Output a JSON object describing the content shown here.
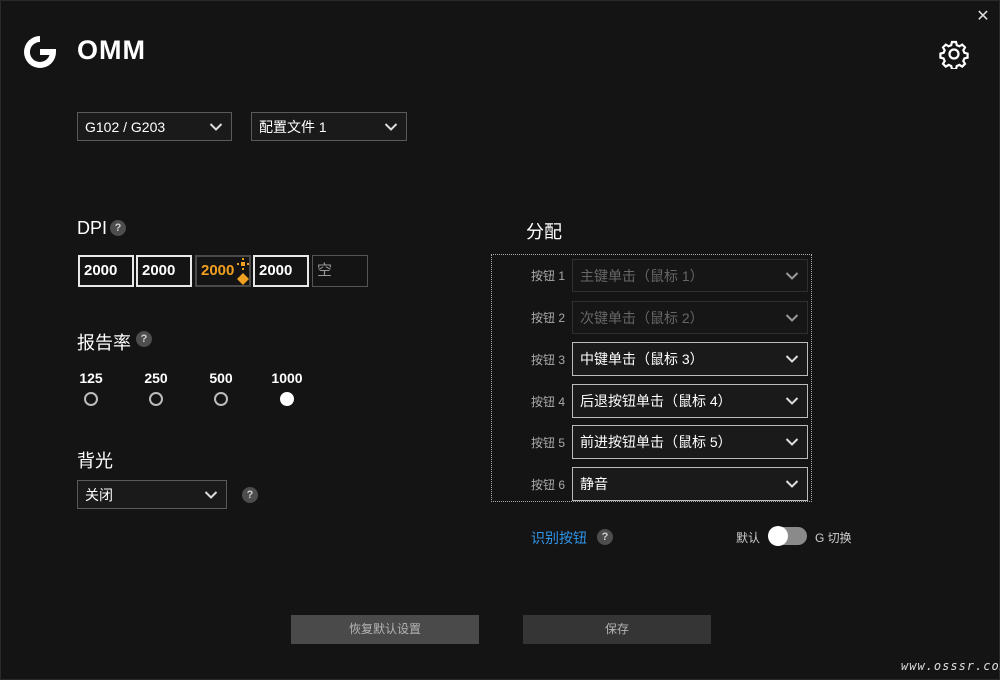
{
  "app": {
    "name": "OMM",
    "close_glyph": "✕"
  },
  "top": {
    "device": "G102 / G203",
    "profile": "配置文件 1"
  },
  "dpi": {
    "heading": "DPI",
    "help": "?",
    "values": [
      "2000",
      "2000",
      "2000",
      "2000",
      "空"
    ],
    "active_index": 2
  },
  "report_rate": {
    "heading": "报告率",
    "help": "?",
    "options": [
      "125",
      "250",
      "500",
      "1000"
    ],
    "selected": "1000"
  },
  "backlight": {
    "heading": "背光",
    "value": "关闭",
    "help": "?"
  },
  "assign": {
    "heading": "分配",
    "rows": [
      {
        "label": "按钮 1",
        "value": "主键单击（鼠标 1）",
        "disabled": true
      },
      {
        "label": "按钮 2",
        "value": "次键单击（鼠标 2）",
        "disabled": true
      },
      {
        "label": "按钮 3",
        "value": "中键单击（鼠标 3）",
        "disabled": false
      },
      {
        "label": "按钮 4",
        "value": "后退按钮单击（鼠标 4）",
        "disabled": false
      },
      {
        "label": "按钮 5",
        "value": "前进按钮单击（鼠标 5）",
        "disabled": false
      },
      {
        "label": "按钮 6",
        "value": "静音",
        "disabled": false
      }
    ],
    "identify": "识别按钮",
    "help": "?",
    "toggle_left": "默认",
    "toggle_right": "G 切换"
  },
  "footer": {
    "restore": "恢复默认设置",
    "save": "保存"
  },
  "watermark": "www.osssr.com",
  "colors": {
    "accent": "#f0a020",
    "link": "#2f95e8",
    "bg": "#141414"
  }
}
